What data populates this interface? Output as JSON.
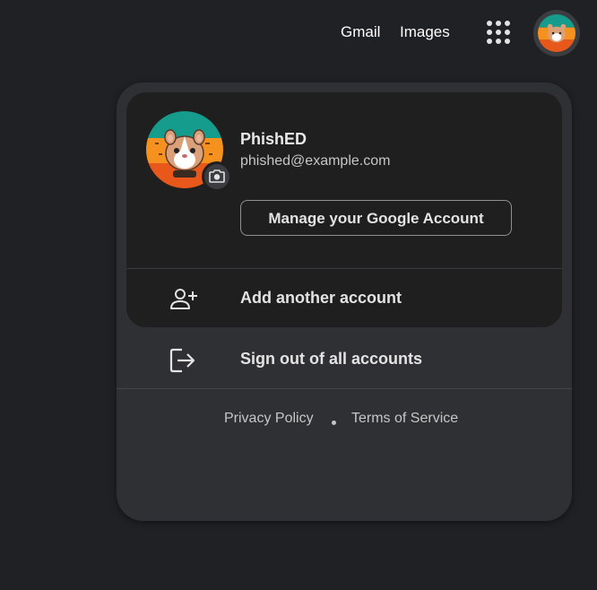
{
  "header": {
    "gmail_label": "Gmail",
    "images_label": "Images",
    "apps_icon": "google-apps-grid-icon"
  },
  "account": {
    "name": "PhishED",
    "email": "phished@example.com",
    "manage_label": "Manage your Google Account",
    "avatar": "hamster-avatar",
    "camera_icon": "camera-icon"
  },
  "menu": {
    "add_account_label": "Add another account",
    "add_account_icon": "person-add-icon",
    "sign_out_label": "Sign out of all accounts",
    "sign_out_icon": "logout-icon"
  },
  "footer": {
    "privacy_label": "Privacy Policy",
    "terms_label": "Terms of Service"
  },
  "colors": {
    "page_bg": "#202124",
    "panel_bg": "#2f3033",
    "card_bg": "#1f1f1f",
    "avatar_teal": "#169c8c",
    "avatar_orange": "#f5921f",
    "avatar_red_orange": "#e8581a"
  }
}
